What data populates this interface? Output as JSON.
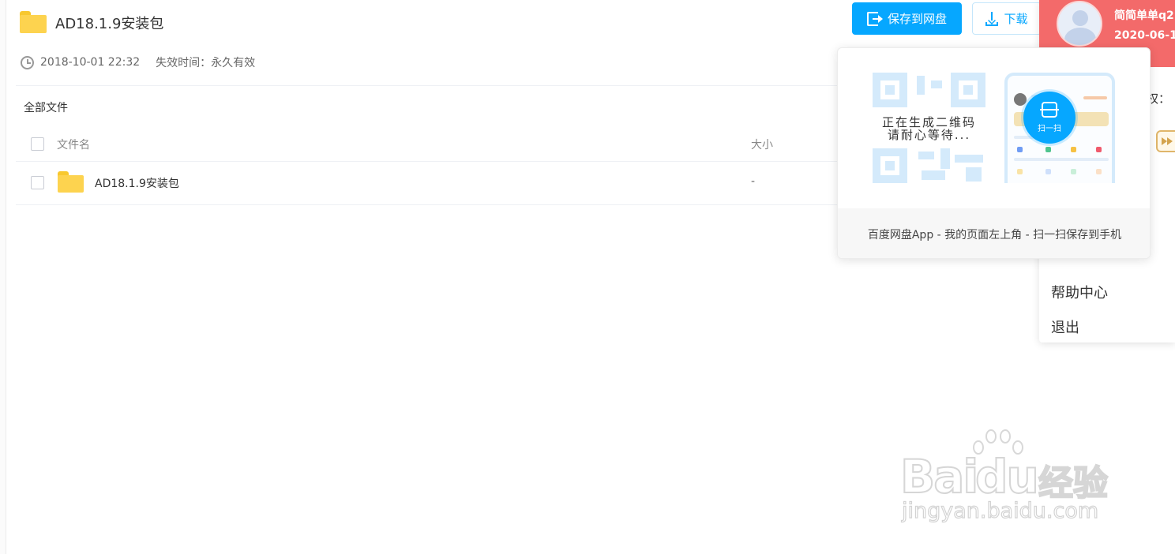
{
  "header": {
    "title": "AD18.1.9安装包",
    "date": "2018-10-01 22:32",
    "expire_label": "失效时间：永久有效",
    "save_button": "保存到网盘",
    "download_button": "下载"
  },
  "files": {
    "breadcrumb": "全部文件",
    "columns": {
      "name": "文件名",
      "size": "大小"
    },
    "rows": [
      {
        "name": "AD18.1.9安装包",
        "size": "-",
        "type": "folder-icon"
      }
    ]
  },
  "user_panel": {
    "username": "简简单单q2",
    "date": "2020-06-1(",
    "partial_label": "权：",
    "menu": [
      "帮助中心",
      "退出"
    ],
    "accent_color": "#f36a6a"
  },
  "qr_popup": {
    "status_text_1": "正在生成二维码",
    "status_text_2": "请耐心等待...",
    "scan_label": "扫一扫",
    "footer": "百度网盘App - 我的页面左上角 - 扫一扫保存到手机"
  },
  "watermark": {
    "brand": "Bai",
    "brand_tail": "du",
    "product": "经验",
    "url": "jingyan.baidu.com"
  },
  "colors": {
    "primary": "#06a7ff",
    "folder": "#fdd34f"
  }
}
